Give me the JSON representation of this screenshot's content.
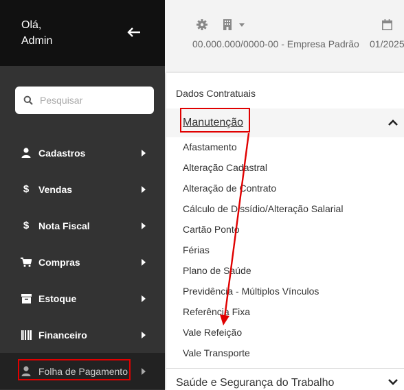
{
  "sidebar": {
    "greeting_line1": "Olá,",
    "greeting_line2": "Admin",
    "back_icon": "arrow-left-icon",
    "search": {
      "placeholder": "Pesquisar",
      "value": ""
    },
    "items": [
      {
        "label": "Cadastros",
        "icon": "user-icon"
      },
      {
        "label": "Vendas",
        "icon": "dollar-icon"
      },
      {
        "label": "Nota Fiscal",
        "icon": "dollar-icon"
      },
      {
        "label": "Compras",
        "icon": "cart-icon"
      },
      {
        "label": "Estoque",
        "icon": "archive-icon"
      },
      {
        "label": "Financeiro",
        "icon": "barcode-icon"
      },
      {
        "label": "Folha de Pagamento",
        "icon": "user-icon",
        "active": true
      }
    ]
  },
  "header": {
    "company": "00.000.000/0000-00 - Empresa Padrão",
    "date": "01/2025"
  },
  "menu": {
    "top_link": "Dados Contratuais",
    "section_title": "Manutenção",
    "section_items": [
      "Afastamento",
      "Alteração Cadastral",
      "Alteração de Contrato",
      "Cálculo de Dissídio/Alteração Salarial",
      "Cartão Ponto",
      "Férias",
      "Plano de Saúde",
      "Previdência - Múltiplos Vínculos",
      "Referência Fixa",
      "Vale Refeição",
      "Vale Transporte"
    ],
    "bottom_section_title": "Saúde e Segurança do Trabalho"
  },
  "colors": {
    "sidebar_bg": "#333333",
    "sidebar_top_bg": "#111111",
    "annotation_red": "#e00000"
  }
}
